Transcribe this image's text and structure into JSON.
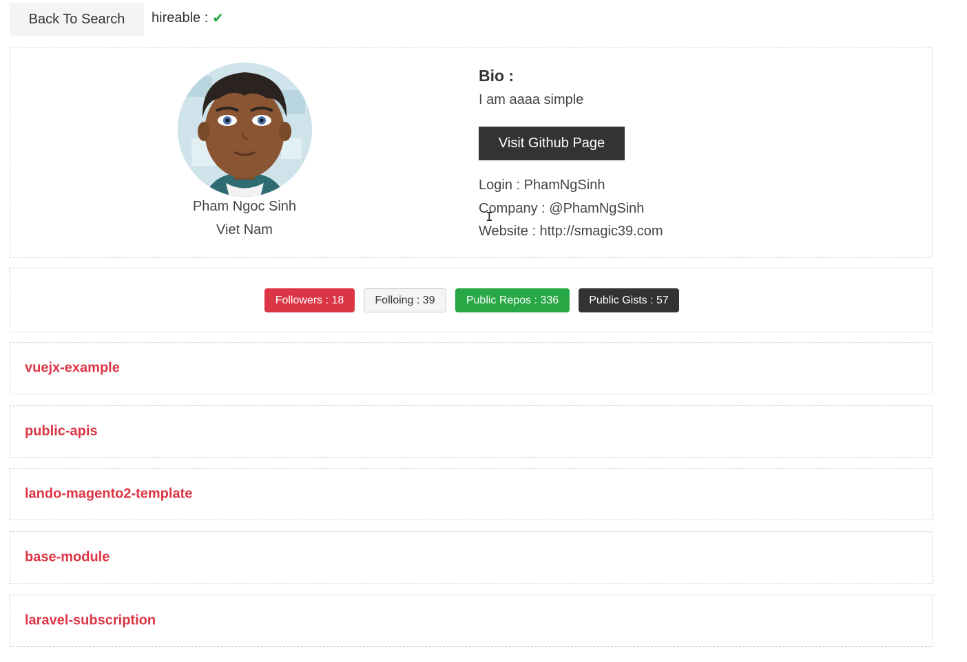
{
  "topbar": {
    "back_label": "Back To Search",
    "hireable_label": "hireable :",
    "hireable_icon": "check-icon"
  },
  "profile": {
    "name": "Pham Ngoc Sinh",
    "location": "Viet Nam",
    "bio_title": "Bio :",
    "bio": "I am aaaa simple",
    "github_button": "Visit Github Page",
    "login": "Login : PhamNgSinh",
    "company": "Company : @PhamNgSinh",
    "website": "Website : http://smagic39.com"
  },
  "stats": {
    "followers": "Followers : 18",
    "following": "Folloing : 39",
    "public_repos": "Public Repos : 336",
    "public_gists": "Public Gists : 57"
  },
  "repos": [
    {
      "name": "vuejx-example"
    },
    {
      "name": "public-apis"
    },
    {
      "name": "lando-magento2-template"
    },
    {
      "name": "base-module"
    },
    {
      "name": "laravel-subscription"
    }
  ],
  "colors": {
    "accent_red": "#dc3545",
    "success_green": "#28a745",
    "dark": "#333333"
  }
}
